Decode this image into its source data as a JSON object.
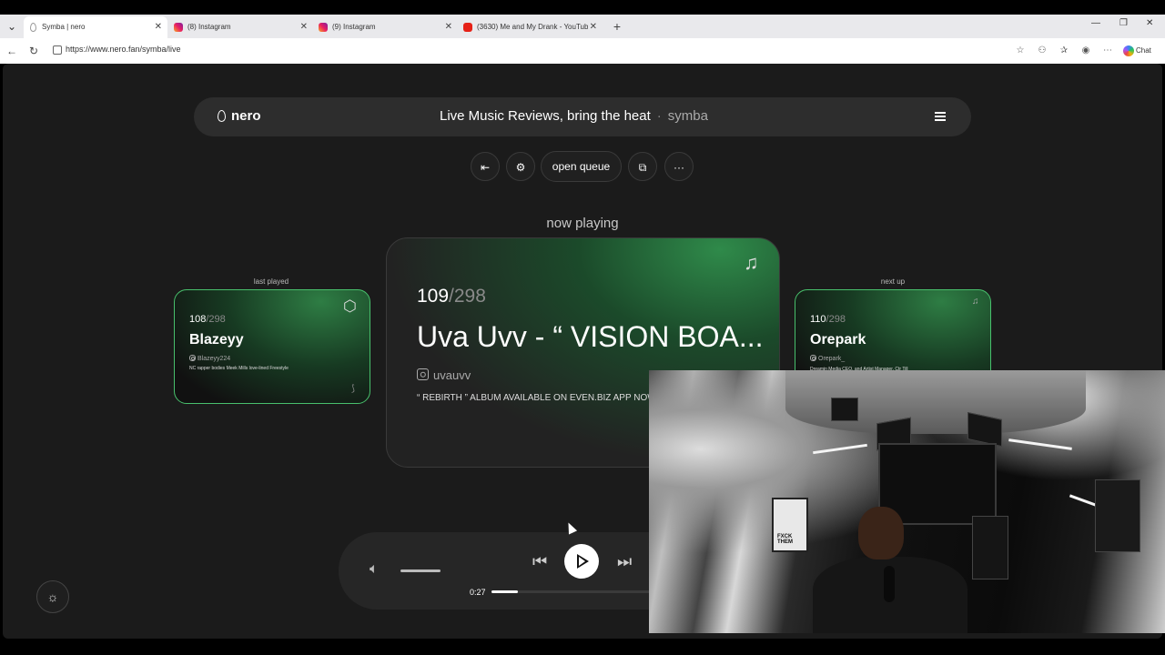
{
  "browser": {
    "tabs": [
      {
        "title": "Symba | nero",
        "active": true,
        "favicon": "nero-drop-icon"
      },
      {
        "title": "(8) Instagram",
        "active": false,
        "favicon": "instagram-icon"
      },
      {
        "title": "(9) Instagram",
        "active": false,
        "favicon": "instagram-icon"
      },
      {
        "title": "(3630) Me and My Drank - YouTube",
        "active": false,
        "favicon": "youtube-icon"
      }
    ],
    "url": "https://www.nero.fan/symba/live",
    "chat_label": "Chat"
  },
  "header": {
    "logo": "nero",
    "title": "Live Music Reviews, bring the heat",
    "separator": "·",
    "username": "symba"
  },
  "controls": {
    "open_queue": "open queue"
  },
  "now_playing_label": "now playing",
  "last_played": {
    "label": "last played",
    "number": "108",
    "total": "/298",
    "title": "Blazeyy",
    "handle": "Blazeyy224",
    "description": "NC rapper bodies Meek Mills love-lined Freestyle"
  },
  "current": {
    "number": "109",
    "total": "/298",
    "title": "Uva Uvv - “ VISION BOA...",
    "handle": "uvauvv",
    "description": "“ REBIRTH ” ALBUM AVAILABLE ON EVEN.BIZ APP NOW"
  },
  "next_up": {
    "label": "next up",
    "number": "110",
    "total": "/298",
    "title": "Orepark",
    "handle": "Orepark_",
    "description": "Dreamin Media CEO, and Artist Manager. Ctr Till"
  },
  "player": {
    "elapsed": "0:27",
    "volume_level": 1.0,
    "progress": 0.12
  },
  "webcam": {
    "frame_text": "FXCK THEM"
  },
  "colors": {
    "accent_green": "#48c06c",
    "background": "#1b1b1b"
  }
}
